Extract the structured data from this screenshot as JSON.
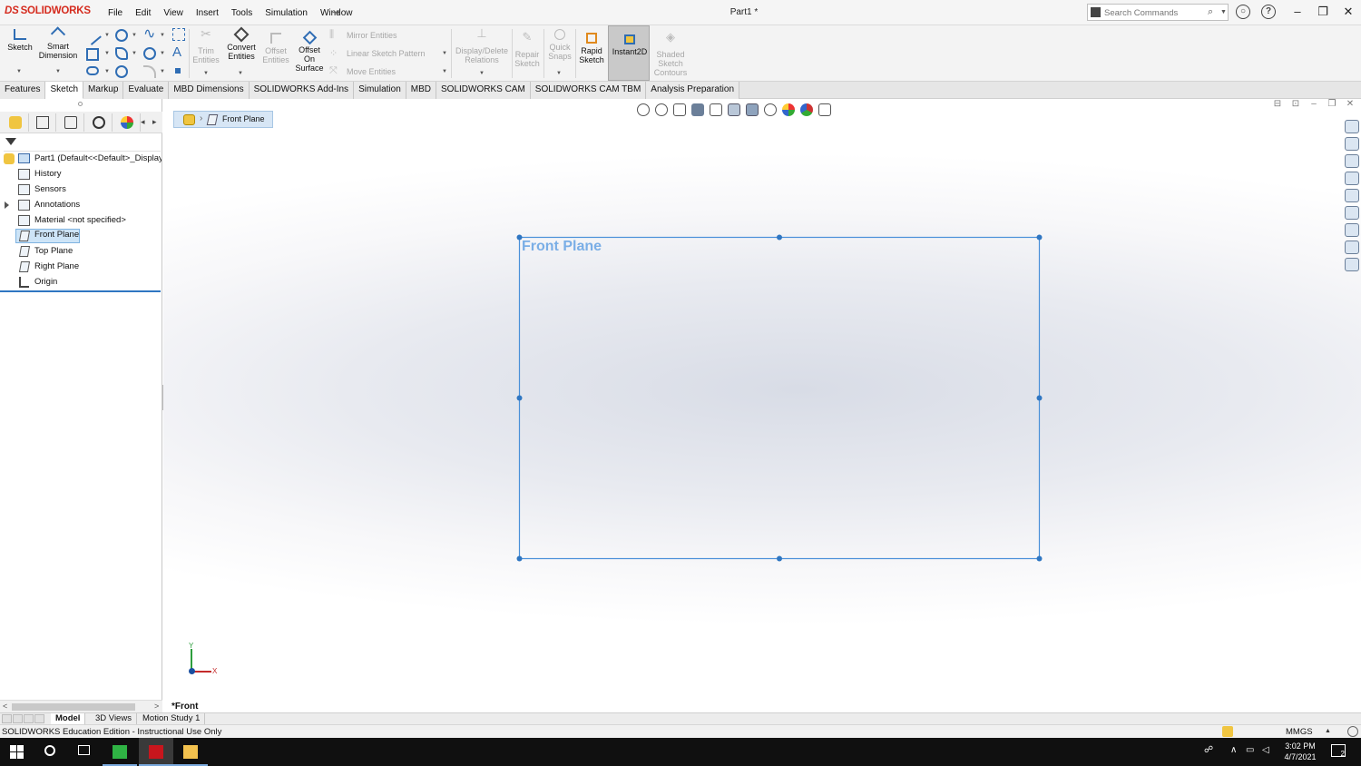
{
  "app": {
    "logo_text": "SOLIDWORKS",
    "document_title": "Part1 *",
    "menu": [
      "File",
      "Edit",
      "View",
      "Insert",
      "Tools",
      "Simulation",
      "Window"
    ]
  },
  "search": {
    "placeholder": "Search Commands"
  },
  "ribbon": {
    "sketch": "Sketch",
    "smart_dimension": "Smart Dimension",
    "trim_entities": "Trim Entities",
    "convert_entities": "Convert Entities",
    "offset_entities": "Offset Entities",
    "offset_on_surface": "Offset On Surface",
    "mirror_entities": "Mirror Entities",
    "linear_sketch_pattern": "Linear Sketch Pattern",
    "move_entities": "Move Entities",
    "display_delete_relations": "Display/Delete Relations",
    "repair_sketch": "Repair Sketch",
    "quick_snaps": "Quick Snaps",
    "rapid_sketch": "Rapid Sketch",
    "instant2d": "Instant2D",
    "shaded_sketch_contours": "Shaded Sketch Contours"
  },
  "tabs": [
    {
      "label": "Features"
    },
    {
      "label": "Sketch",
      "active": true
    },
    {
      "label": "Markup"
    },
    {
      "label": "Evaluate"
    },
    {
      "label": "MBD Dimensions"
    },
    {
      "label": "SOLIDWORKS Add-Ins"
    },
    {
      "label": "Simulation"
    },
    {
      "label": "MBD"
    },
    {
      "label": "SOLIDWORKS CAM"
    },
    {
      "label": "SOLIDWORKS CAM TBM"
    },
    {
      "label": "Analysis Preparation"
    }
  ],
  "tree": {
    "root": "Part1  (Default<<Default>_Display",
    "items": [
      {
        "label": "History"
      },
      {
        "label": "Sensors"
      },
      {
        "label": "Annotations"
      },
      {
        "label": "Material <not specified>"
      },
      {
        "label": "Front Plane",
        "selected": true
      },
      {
        "label": "Top Plane"
      },
      {
        "label": "Right Plane"
      },
      {
        "label": "Origin"
      }
    ]
  },
  "viewport": {
    "breadcrumb": "Front Plane",
    "plane_label": "Front Plane",
    "view_name": "*Front",
    "triad_x": "X",
    "triad_y": "Y",
    "colors": {
      "plane": "#4a90d9",
      "triad_x": "#c42b2b",
      "triad_y": "#2e9e3e"
    }
  },
  "bottom_tabs": [
    "Model",
    "3D Views",
    "Motion Study 1"
  ],
  "status": {
    "text": "SOLIDWORKS Education Edition - Instructional Use Only",
    "units": "MMGS"
  },
  "taskbar": {
    "time": "3:02 PM",
    "date": "4/7/2021",
    "notifications": "2"
  }
}
